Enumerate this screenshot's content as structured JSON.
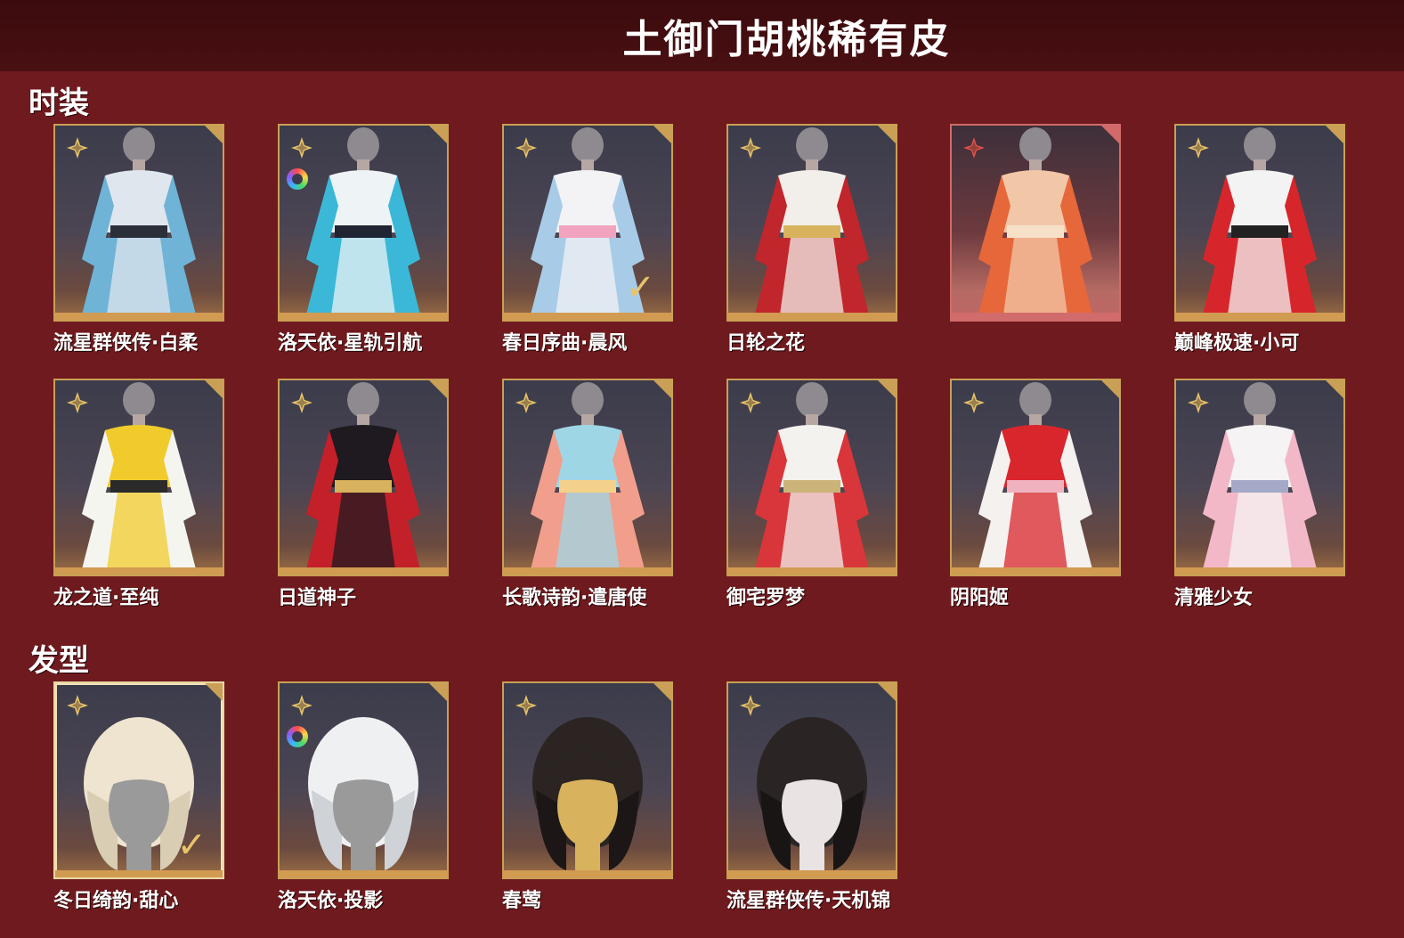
{
  "header": {
    "title": "土御门胡桃稀有皮"
  },
  "sections": {
    "outfits": {
      "title": "时装"
    },
    "hair": {
      "title": "发型"
    }
  },
  "colors": {
    "background": "#6f1a1e",
    "header": "#3a0b0d",
    "card_border_gold": "#c9a055",
    "card_border_rare": "#d26a6a",
    "star_gold": "#e8c46a",
    "star_red": "#e0504a"
  },
  "outfits": [
    {
      "name": "流星群侠传·白柔",
      "icon": "gold-star-icon",
      "variant": "outfit-white-blue"
    },
    {
      "name": "洛天依·星轨引航",
      "icon": "gold-star-icon",
      "has_color_ring": true,
      "variant": "outfit-white-cyan"
    },
    {
      "name": "春日序曲·晨风",
      "icon": "gold-star-icon",
      "owned_check": true,
      "variant": "outfit-sailor"
    },
    {
      "name": "日轮之花",
      "icon": "gold-star-icon",
      "variant": "outfit-white-red"
    },
    {
      "name": "",
      "icon": "red-star-icon",
      "rare": true,
      "variant": "outfit-flame"
    },
    {
      "name": "巅峰极速·小可",
      "icon": "gold-star-icon",
      "variant": "outfit-racer"
    },
    {
      "name": "龙之道·至纯",
      "icon": "gold-star-icon",
      "variant": "outfit-yellow"
    },
    {
      "name": "日道神子",
      "icon": "gold-star-icon",
      "variant": "outfit-black-red"
    },
    {
      "name": "长歌诗韵·遣唐使",
      "icon": "gold-star-icon",
      "variant": "outfit-pastel"
    },
    {
      "name": "御宅罗梦",
      "icon": "gold-star-icon",
      "variant": "outfit-shrine-white"
    },
    {
      "name": "阴阳姬",
      "icon": "gold-star-icon",
      "variant": "outfit-shrine-red"
    },
    {
      "name": "清雅少女",
      "icon": "gold-star-icon",
      "variant": "outfit-pink-white"
    }
  ],
  "hairstyles": [
    {
      "name": "冬日绮韵·甜心",
      "icon": "gold-star-icon",
      "selected": true,
      "owned_check": true,
      "variant": "hair-blonde-wavy"
    },
    {
      "name": "洛天依·投影",
      "icon": "gold-star-icon",
      "has_color_ring": true,
      "variant": "hair-white-short"
    },
    {
      "name": "春莺",
      "icon": "gold-star-icon",
      "variant": "hair-dark-bun"
    },
    {
      "name": "流星群侠传·天机锦",
      "icon": "gold-star-icon",
      "variant": "hair-dark-ponytail"
    }
  ],
  "check_glyph": "✓"
}
